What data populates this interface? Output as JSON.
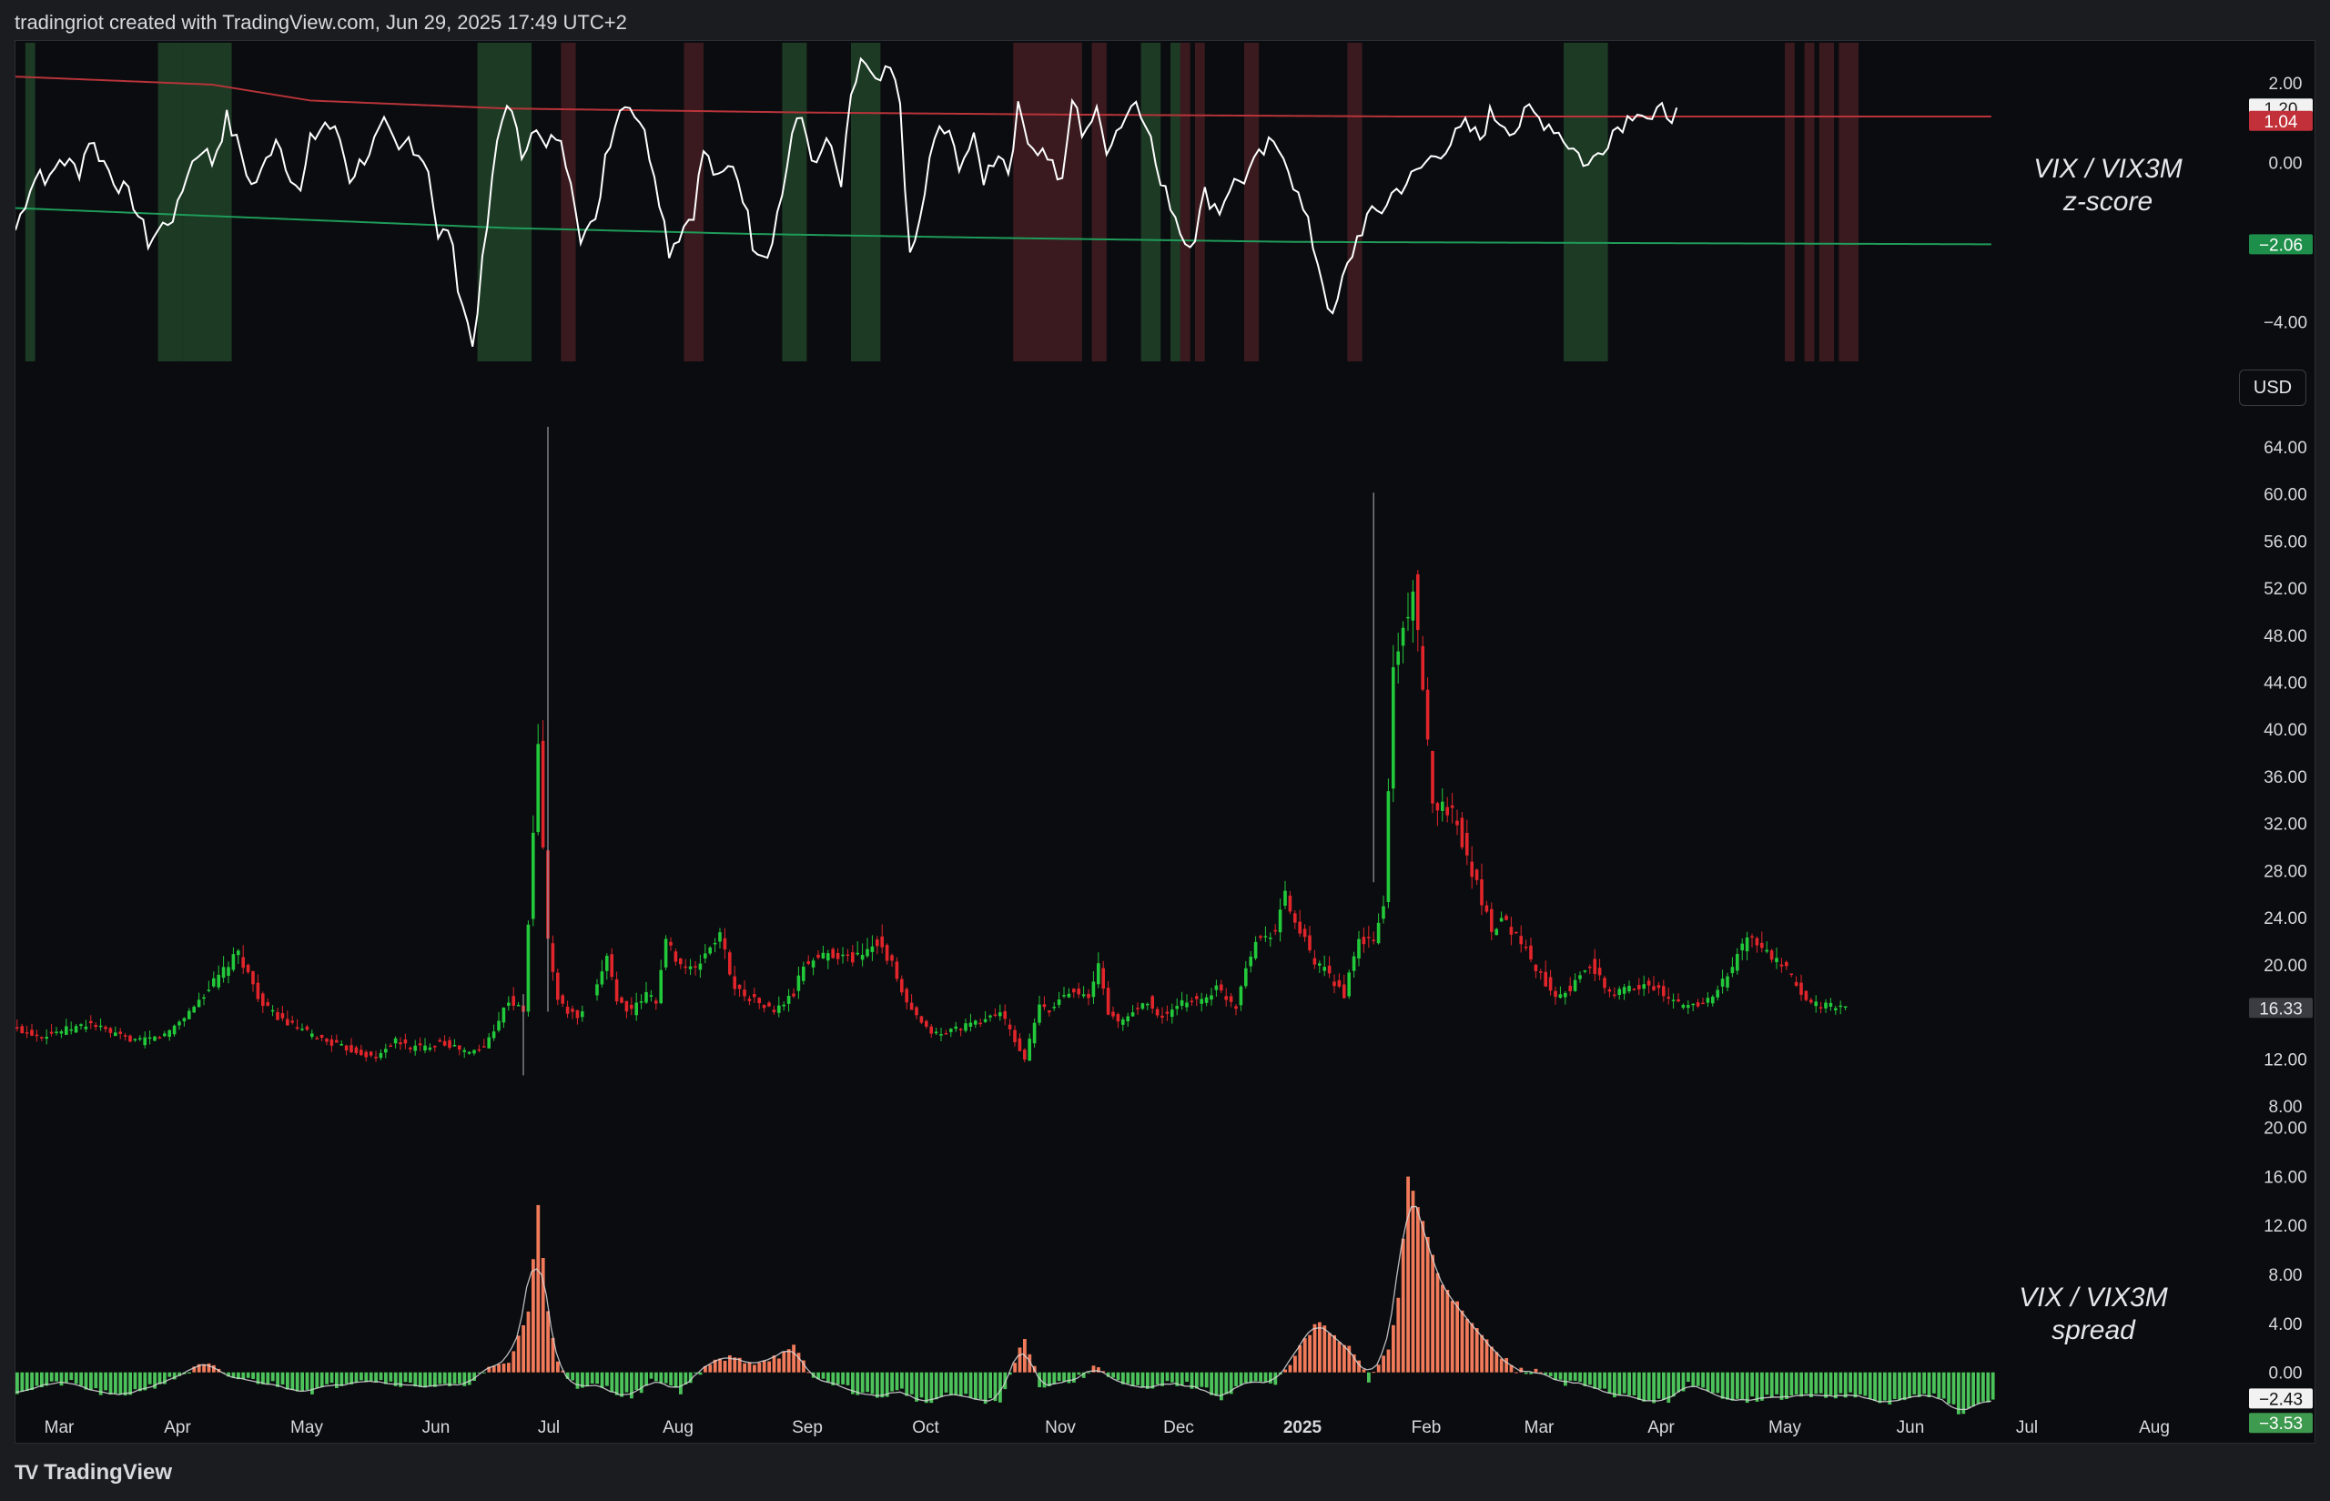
{
  "header": {
    "text": "tradingriot created with TradingView.com, Jun 29, 2025 17:49 UTC+2"
  },
  "footer": {
    "brand": "TradingView",
    "logo_glyph": "TV"
  },
  "currency_button": "USD",
  "colors": {
    "background": "#0b0c0f",
    "up": "#22c93a",
    "down": "#e2252b",
    "zscore_line": "#ffffff",
    "upper_band": "#b8343a",
    "lower_band": "#1f9c5a",
    "green_zone": "#1c3a24",
    "red_zone": "#3a1a1e",
    "spread_pos": "#f07a5a",
    "spread_neg": "#4cc25a"
  },
  "time_axis": {
    "labels": [
      "Mar",
      "Apr",
      "May",
      "Jun",
      "Jul",
      "Aug",
      "Sep",
      "Oct",
      "Nov",
      "Dec",
      "2025",
      "Feb",
      "Mar",
      "Apr",
      "May",
      "Jun",
      "Jul",
      "Aug"
    ],
    "bold_label": "2025"
  },
  "zscore_pane": {
    "title_line1": "VIX / VIX3M",
    "title_line2": "z-score",
    "ticks": [
      "2.00",
      "0.00",
      "−4.00"
    ],
    "badges": [
      {
        "text": "1.04",
        "value": 1.04,
        "color": "#c2313a"
      },
      {
        "text": "−2.06",
        "value": -2.06,
        "color": "#1e8f4a"
      }
    ],
    "hidden_badge_text": "1.20"
  },
  "price_pane": {
    "ticks": [
      "64.00",
      "60.00",
      "56.00",
      "52.00",
      "48.00",
      "44.00",
      "40.00",
      "36.00",
      "32.00",
      "28.00",
      "24.00",
      "20.00",
      "12.00",
      "8.00"
    ],
    "last_price": {
      "text": "16.33",
      "value": 16.33
    }
  },
  "spread_pane": {
    "title_line1": "VIX / VIX3M",
    "title_line2": "spread",
    "ticks": [
      "20.00",
      "16.00",
      "12.00",
      "8.00",
      "4.00",
      "0.00"
    ],
    "badges": [
      {
        "text": "−2.43",
        "value": -2.43
      },
      {
        "text": "−3.53",
        "value": -3.53
      }
    ]
  },
  "chart_data": [
    {
      "type": "line",
      "name": "VIX / VIX3M z-score",
      "x_range": [
        "2024-02-20",
        "2025-08-20"
      ],
      "ylim": [
        -5,
        3
      ],
      "anchors_x": [
        0,
        3,
        5,
        7,
        9,
        13,
        15,
        17,
        20,
        24,
        27,
        30,
        33,
        35,
        38,
        40,
        43,
        46,
        48,
        50,
        53,
        55,
        58,
        60,
        63,
        66,
        68,
        72,
        75,
        78,
        80,
        84,
        86,
        88,
        90,
        93,
        96,
        98,
        100,
        103,
        105,
        108,
        110,
        113,
        115,
        118,
        120,
        122,
        124,
        127,
        130,
        133,
        135,
        138,
        140,
        143,
        146,
        148,
        150,
        153,
        156,
        158,
        160,
        163,
        165,
        168,
        170,
        172,
        175,
        178,
        180,
        182,
        184,
        186,
        188,
        190,
        192,
        195,
        197,
        200,
        202,
        204,
        207,
        210,
        213,
        215,
        217,
        220,
        222,
        225,
        228,
        230,
        233,
        235,
        238,
        240,
        242,
        245,
        247,
        250,
        253,
        255,
        258,
        260,
        263,
        265,
        268,
        270,
        273,
        275,
        278,
        280,
        283,
        285,
        287,
        290,
        292,
        295,
        298,
        300,
        303,
        305,
        308,
        310,
        313,
        315,
        318,
        320,
        323,
        325,
        328,
        330,
        333,
        335,
        338,
        340,
        342,
        345,
        347,
        350,
        353,
        355,
        358,
        360,
        362,
        365,
        368,
        370,
        373,
        375,
        378,
        380,
        382,
        385,
        388,
        390,
        392,
        395,
        398,
        400,
        402
      ],
      "anchors_y": [
        -1.7,
        -0.6,
        -0.2,
        -0.5,
        0.1,
        -0.2,
        0.6,
        0.2,
        -0.4,
        -1.0,
        -2.0,
        -1.6,
        -1.2,
        -0.2,
        0.4,
        0.0,
        1.1,
        0.2,
        -0.6,
        -0.3,
        0.7,
        0.0,
        -0.8,
        0.5,
        1.0,
        0.6,
        -0.4,
        0.3,
        0.9,
        0.2,
        0.6,
        -0.1,
        -2.0,
        -1.6,
        -3.0,
        -4.6,
        -1.6,
        0.5,
        1.6,
        0.2,
        0.9,
        0.3,
        0.7,
        -0.3,
        -1.8,
        -1.6,
        0.2,
        1.0,
        1.6,
        1.1,
        -0.2,
        -2.2,
        -1.8,
        -1.2,
        0.3,
        -0.5,
        0.0,
        -0.8,
        -2.0,
        -2.3,
        -0.8,
        0.7,
        1.1,
        -0.2,
        0.6,
        -0.6,
        1.5,
        2.6,
        1.9,
        2.3,
        1.5,
        -2.5,
        -1.5,
        0.0,
        0.9,
        0.6,
        0.0,
        0.5,
        -0.4,
        0.3,
        -0.2,
        1.3,
        0.4,
        0.2,
        -0.6,
        1.6,
        0.8,
        1.2,
        0.4,
        1.0,
        1.6,
        1.1,
        -0.6,
        -1.0,
        -2.0,
        -1.8,
        -0.8,
        -1.2,
        -0.6,
        -0.4,
        0.1,
        0.4,
        0.3,
        -0.5,
        -1.6,
        -2.5,
        -4.0,
        -3.0,
        -1.9,
        -1.4,
        -1.2,
        -0.8,
        -0.5,
        -0.3,
        0.0,
        0.3,
        0.5,
        0.9,
        0.6,
        1.2,
        1.0,
        0.8,
        1.3,
        1.1,
        0.9,
        0.6,
        0.2,
        -0.1,
        0.4,
        0.8,
        1.1,
        1.4,
        1.0,
        1.3,
        1.2
      ],
      "upper_band_anchors_x": [
        0,
        40,
        60,
        100,
        160,
        210,
        280,
        402
      ],
      "upper_band_anchors_y": [
        2.15,
        1.95,
        1.55,
        1.35,
        1.25,
        1.2,
        1.15,
        1.15
      ],
      "lower_band_anchors_x": [
        0,
        40,
        100,
        150,
        200,
        260,
        402
      ],
      "lower_band_anchors_y": [
        -1.15,
        -1.35,
        -1.65,
        -1.8,
        -1.9,
        -2.0,
        -2.06
      ],
      "green_zones": [
        [
          2,
          3
        ],
        [
          29,
          33
        ],
        [
          34,
          43
        ],
        [
          94,
          104
        ],
        [
          156,
          160
        ],
        [
          170,
          175
        ],
        [
          229,
          232
        ],
        [
          235,
          238
        ],
        [
          315,
          323
        ]
      ],
      "red_zones": [
        [
          111,
          113
        ],
        [
          136,
          139
        ],
        [
          203,
          216
        ],
        [
          219,
          221
        ],
        [
          237,
          238
        ],
        [
          240,
          241
        ],
        [
          250,
          252
        ],
        [
          271,
          273
        ],
        [
          360,
          361
        ],
        [
          364,
          365
        ],
        [
          367,
          369
        ],
        [
          371,
          374
        ]
      ]
    },
    {
      "type": "candlestick",
      "name": "VIX",
      "ylim": [
        8,
        66
      ],
      "anchors_x": [
        0,
        5,
        10,
        15,
        20,
        25,
        30,
        35,
        40,
        45,
        50,
        55,
        60,
        63,
        66,
        70,
        73,
        75,
        77,
        80,
        83,
        86,
        89,
        92,
        95,
        100,
        103,
        106,
        108,
        110,
        112,
        114,
        116,
        118,
        120,
        122,
        125,
        128,
        130,
        132,
        135,
        138,
        140,
        143,
        146,
        150,
        154,
        158,
        160,
        165,
        170,
        175,
        178,
        180,
        182,
        185,
        188,
        190,
        195,
        200,
        203,
        205,
        208,
        210,
        213,
        215,
        218,
        220,
        222,
        224,
        227,
        230,
        232,
        235,
        238,
        241,
        244,
        248,
        250,
        252,
        254,
        256,
        258,
        260,
        262,
        264,
        266,
        268,
        270,
        273,
        276,
        278,
        280,
        284,
        288,
        292,
        296,
        300,
        302,
        304,
        306,
        310,
        313,
        316,
        320,
        324,
        328,
        332,
        336,
        340,
        344,
        348,
        352,
        356,
        360,
        364,
        368,
        372,
        376,
        380,
        384,
        388,
        393,
        398,
        402
      ],
      "anchors_close": [
        14.5,
        14,
        14.5,
        15,
        14,
        13.5,
        14,
        16,
        18.5,
        21,
        16.5,
        15,
        14,
        13.5,
        13,
        12.5,
        12,
        13,
        13.5,
        13,
        13,
        13.5,
        13,
        12.5,
        13,
        17,
        16,
        38.5,
        22,
        17,
        16,
        15.5,
        16,
        18,
        21,
        17,
        16,
        17.5,
        17,
        22,
        20,
        19.5,
        21,
        22.5,
        18,
        17,
        16,
        17.5,
        20,
        21,
        20.5,
        22,
        20,
        17.5,
        16,
        14.5,
        14,
        14.5,
        15,
        16,
        13.5,
        12,
        16.5,
        16,
        17.5,
        18,
        17,
        20,
        16,
        15,
        16,
        17,
        15.5,
        16,
        17,
        17,
        18,
        16.5,
        20,
        22,
        22.5,
        23,
        26,
        23.5,
        22,
        20,
        19.5,
        18.5,
        17.5,
        22,
        22,
        25,
        45,
        52,
        34,
        33,
        28,
        23,
        24,
        23,
        22,
        19,
        17.5,
        18,
        20,
        17.5,
        18,
        18.5,
        17,
        16.5,
        17,
        19,
        22.5,
        21,
        19.5,
        17,
        16.5,
        16.3
      ],
      "outlier_wicks": [
        {
          "x": 108,
          "high": 65.7,
          "low": 16.0
        },
        {
          "x": 103,
          "high": 17.5,
          "low": 10.6
        },
        {
          "x": 276,
          "high": 60.1,
          "low": 27.0
        }
      ],
      "last_close": 16.33
    },
    {
      "type": "bar",
      "name": "VIX / VIX3M spread",
      "ylim": [
        -5,
        21
      ],
      "anchors_x": [
        0,
        10,
        20,
        30,
        38,
        40,
        42,
        50,
        60,
        70,
        80,
        90,
        96,
        100,
        104,
        106,
        108,
        110,
        114,
        118,
        125,
        130,
        135,
        140,
        145,
        150,
        156,
        158,
        162,
        166,
        170,
        175,
        180,
        185,
        190,
        200,
        205,
        208,
        210,
        212,
        215,
        220,
        225,
        230,
        235,
        240,
        245,
        250,
        256,
        260,
        265,
        268,
        272,
        275,
        277,
        279,
        281,
        283,
        286,
        290,
        295,
        300,
        305,
        310,
        315,
        318,
        322,
        328,
        335,
        340,
        345,
        352,
        360,
        372,
        380,
        386,
        390,
        393,
        396,
        400,
        402
      ],
      "anchors_y": [
        -1.5,
        -0.8,
        -2.0,
        -0.8,
        0.6,
        0.4,
        -0.3,
        -0.8,
        -1.5,
        -0.5,
        -1.0,
        -1.2,
        0.2,
        0.8,
        5.0,
        13.5,
        5.0,
        1.0,
        -1.5,
        -1.0,
        -2.0,
        -0.5,
        -1.5,
        0.5,
        1.2,
        0.8,
        1.5,
        2.0,
        -0.5,
        -0.8,
        -1.5,
        -2.0,
        -1.5,
        -2.5,
        -1.8,
        -2.5,
        3.0,
        -1.0,
        -1.0,
        -0.8,
        -0.7,
        0.5,
        -1.0,
        -1.5,
        -0.8,
        -1.2,
        -2.0,
        -0.8,
        -1.0,
        1.5,
        4.2,
        2.8,
        1.6,
        -0.8,
        0.8,
        2.0,
        6.0,
        16.0,
        12.5,
        7.0,
        4.5,
        2.0,
        0.2,
        0.0,
        -0.8,
        -1.0,
        -1.5,
        -2.0,
        -2.5,
        -1.0,
        -1.8,
        -2.2,
        -2.0,
        -1.8,
        -2.5,
        -2.0,
        -2.0,
        -2.4,
        -3.5,
        -2.43,
        -2.43
      ]
    }
  ]
}
